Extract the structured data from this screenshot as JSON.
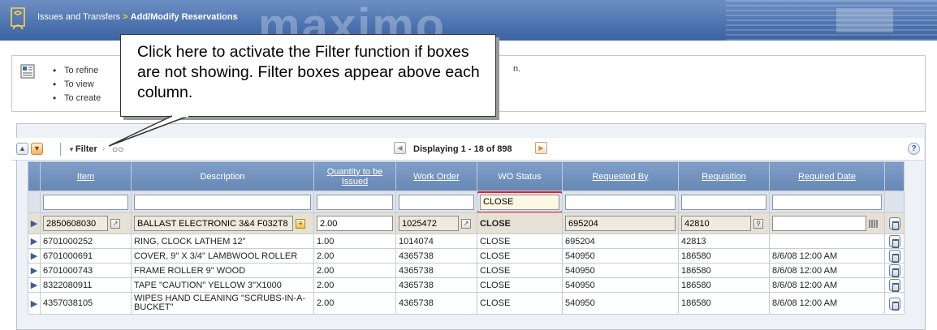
{
  "header": {
    "module": "Issues and Transfers",
    "separator": ">",
    "page": "Add/Modify Reservations",
    "watermark": "maximo"
  },
  "help": {
    "lines": [
      "To refine",
      "To view",
      "To create"
    ],
    "tail": "n."
  },
  "callout": {
    "text": "Click here to activate the Filter function if boxes are not showing. Filter boxes appear above each column."
  },
  "toolbar": {
    "filter_label": "Filter",
    "displaying": "Displaying 1 - 18 of 898",
    "help": "?"
  },
  "table": {
    "columns": [
      "Item",
      "Description",
      "Quantity to be Issued",
      "Work Order",
      "WO Status",
      "Requested By",
      "Requisition",
      "Required Date"
    ],
    "filters": [
      "",
      "",
      "",
      "",
      "CLOSE",
      "",
      "",
      ""
    ],
    "edit_row": {
      "item": "2850608030",
      "description": "BALLAST ELECTRONIC 3&4 F032T8",
      "quantity": "2.00",
      "work_order": "1025472",
      "wo_status": "CLOSE",
      "requested_by": "695204",
      "requisition": "42810",
      "required_date": ""
    },
    "rows": [
      {
        "item": "6701000252",
        "description": "RING, CLOCK LATHEM 12\"",
        "quantity": "1.00",
        "work_order": "1014074",
        "wo_status": "CLOSE",
        "requested_by": "695204",
        "requisition": "42813",
        "required_date": ""
      },
      {
        "item": "6701000691",
        "description": "COVER, 9\" X 3/4\" LAMBWOOL ROLLER",
        "quantity": "2.00",
        "work_order": "4365738",
        "wo_status": "CLOSE",
        "requested_by": "540950",
        "requisition": "186580",
        "required_date": "8/6/08 12:00 AM"
      },
      {
        "item": "6701000743",
        "description": "FRAME ROLLER 9\" WOOD",
        "quantity": "2.00",
        "work_order": "4365738",
        "wo_status": "CLOSE",
        "requested_by": "540950",
        "requisition": "186580",
        "required_date": "8/6/08 12:00 AM"
      },
      {
        "item": "8322080911",
        "description": "TAPE \"CAUTION\" YELLOW 3\"X1000",
        "quantity": "2.00",
        "work_order": "4365738",
        "wo_status": "CLOSE",
        "requested_by": "540950",
        "requisition": "186580",
        "required_date": "8/6/08 12:00 AM"
      },
      {
        "item": "4357038105",
        "description": "WIPES HAND CLEANING \"SCRUBS-IN-A-BUCKET\"",
        "quantity": "2.00",
        "work_order": "4365738",
        "wo_status": "CLOSE",
        "requested_by": "540950",
        "requisition": "186580",
        "required_date": "8/6/08 12:00 AM"
      }
    ]
  },
  "colors": {
    "header_blue": "#4d74b0",
    "column_header": "#7292be",
    "highlight": "#e0202a"
  }
}
